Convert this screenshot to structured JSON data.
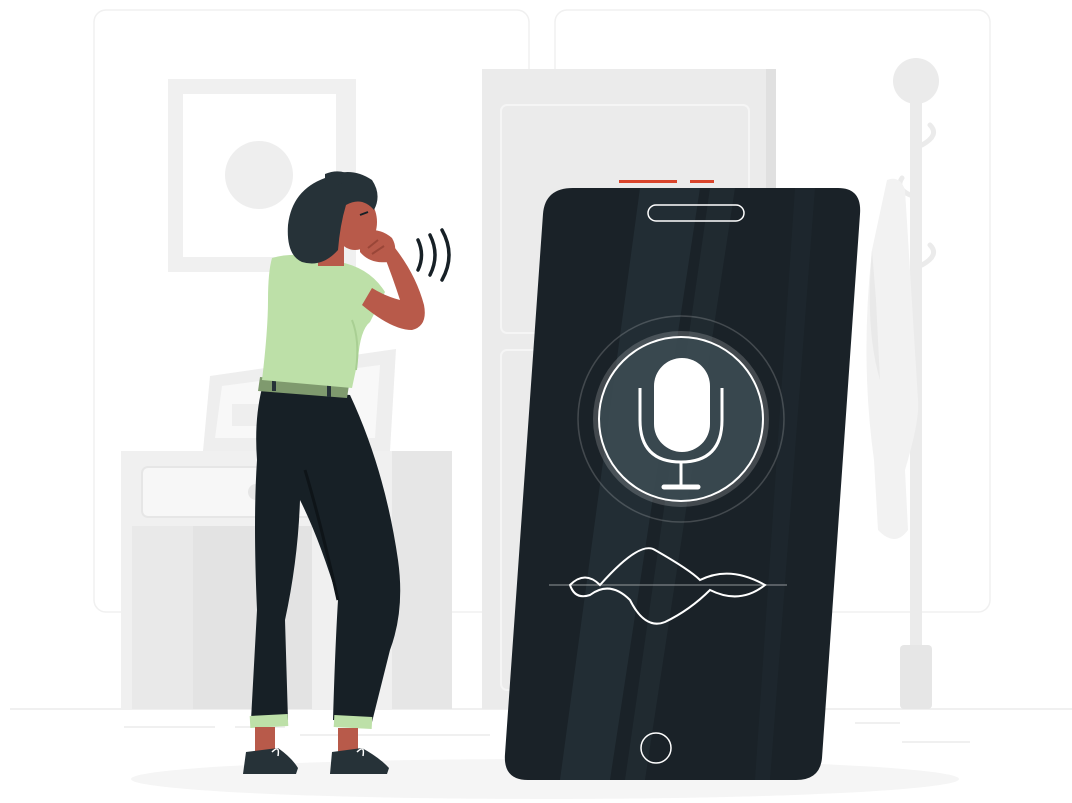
{
  "illustration": {
    "subject": "voice-assistant",
    "icons": [
      "microphone-icon",
      "home-button-icon",
      "sound-waves-icon"
    ],
    "colors": {
      "background": "#ffffff",
      "room_light": "#f5f5f5",
      "room_mid": "#ebebeb",
      "room_dark": "#e0e0e0",
      "phone_body": "#1a2228",
      "phone_glare": "#263238",
      "shirt": "#bde0a8",
      "belt": "#7f9a6e",
      "pants": "#172026",
      "hair": "#263238",
      "skin": "#b85a4a",
      "accent": "#d9452c",
      "waveform": "#ffffff"
    }
  }
}
